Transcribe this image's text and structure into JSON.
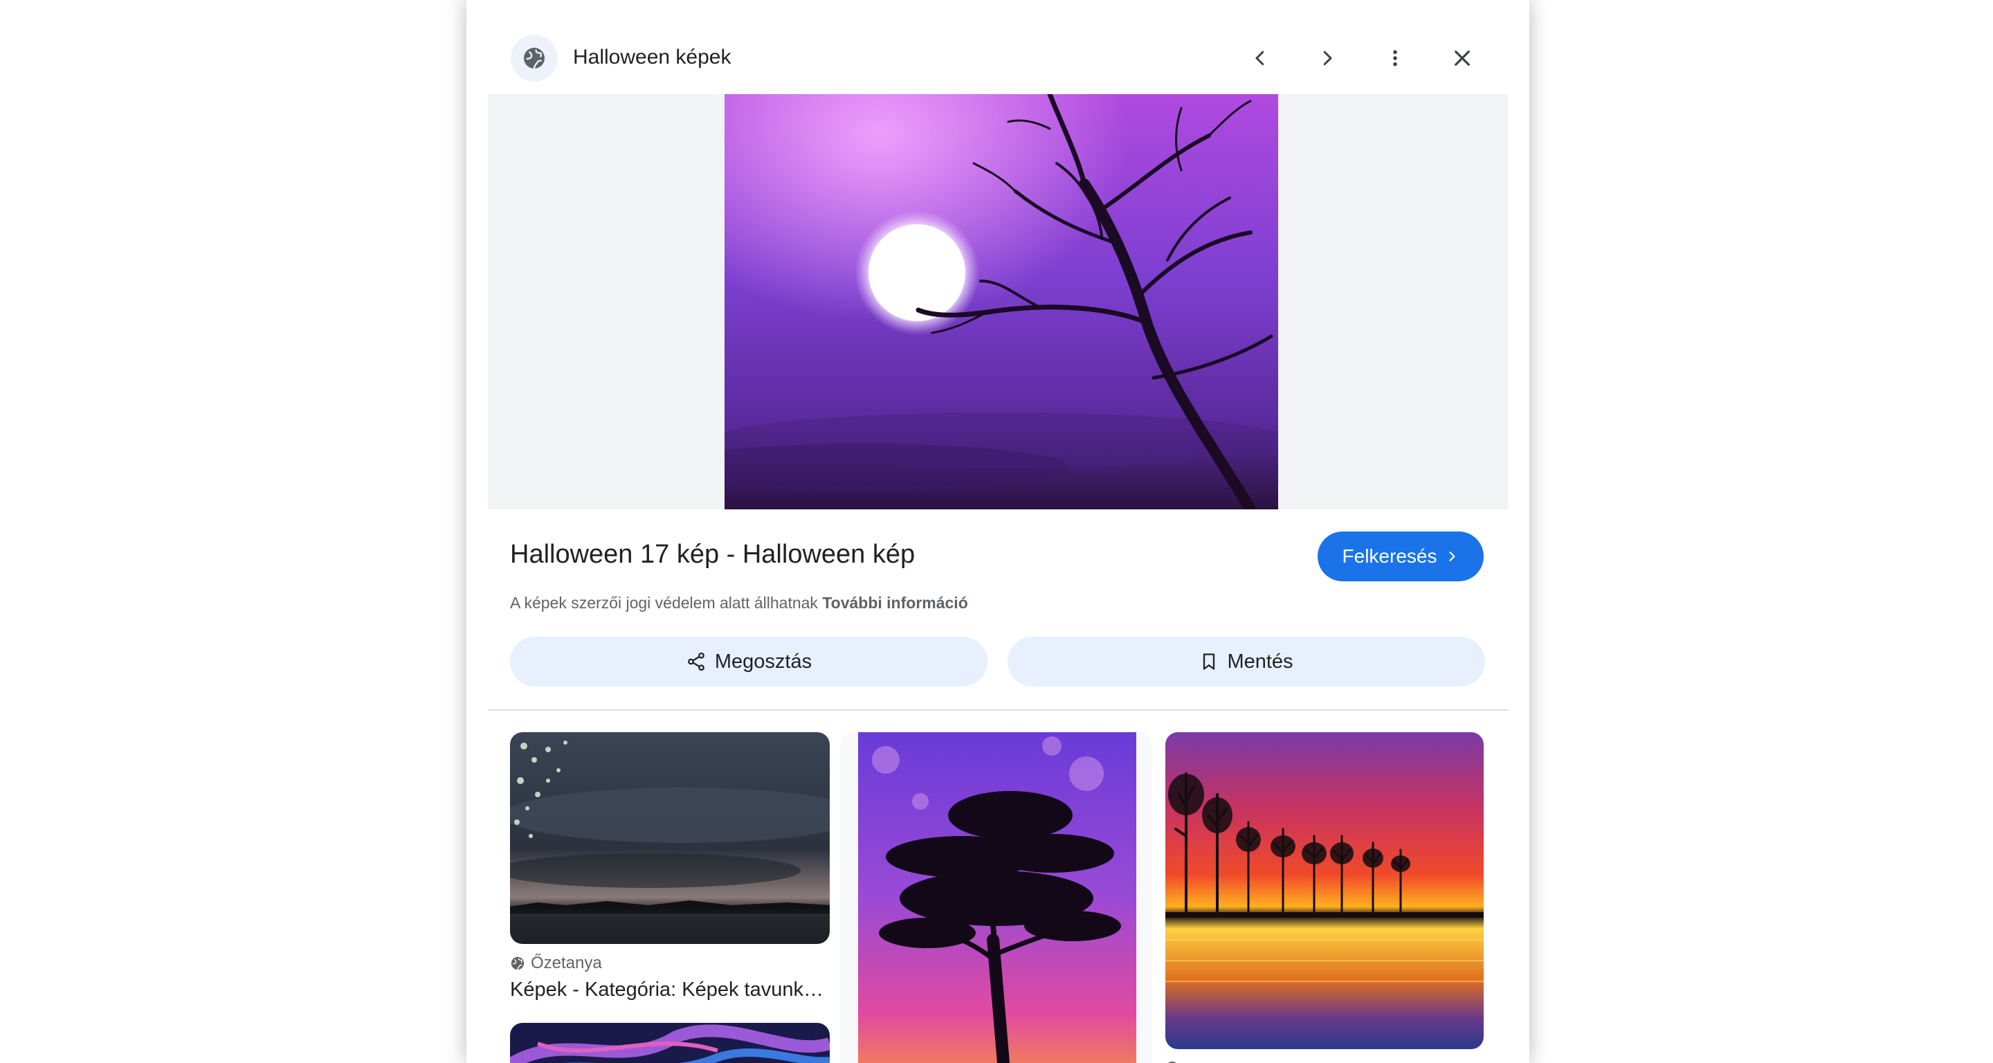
{
  "header": {
    "title": "Halloween képek",
    "site_icon": "globe-icon",
    "prev_icon": "chevron-left-icon",
    "next_icon": "chevron-right-icon",
    "more_icon": "more-vert-icon",
    "close_icon": "close-icon"
  },
  "preview": {
    "image": "purple-moon-bare-tree"
  },
  "info": {
    "title": "Halloween 17 kép - Halloween kép",
    "visit_label": "Felkeresés",
    "copyright_text": "A képek szerzői jogi védelem alatt állhatnak",
    "more_info_link": "További információ"
  },
  "actions": {
    "share_label": "Megosztás",
    "save_label": "Mentés"
  },
  "related": [
    {
      "source": "Őzetanya",
      "title": "Képek - Kategória: Képek tavunk…",
      "image": "stormy-lake-sunset"
    },
    {
      "image": "purple-sky-tree-silhouette"
    },
    {
      "image": "sunset-lake-trees"
    },
    {
      "image": "purple-swirl-art"
    }
  ],
  "colors": {
    "accent": "#1a73e8",
    "tonal_button": "#e8f0fe",
    "text_primary": "#202124",
    "text_secondary": "#5f6368"
  }
}
